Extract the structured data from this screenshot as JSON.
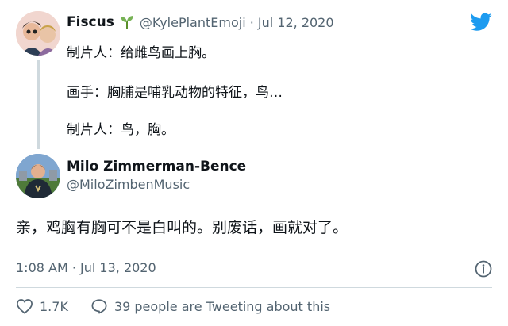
{
  "parent_tweet": {
    "display_name": "Fiscus",
    "handle_date": "@KylePlantEmoji · Jul 12, 2020",
    "lines": [
      "制片人：给雌鸟画上胸。",
      "画手：胸脯是哺乳动物的特征，鸟…",
      "制片人：鸟，胸。"
    ],
    "avatar_icon": "avatar",
    "name_emoji_icon": "seedling-icon"
  },
  "reply_tweet": {
    "display_name": "Milo Zimmerman-Bence",
    "handle": "@MiloZimbenMusic",
    "text": "亲，鸡胸有胸可不是白叫的。别废话，画就对了。",
    "timestamp": "1:08 AM · Jul 13, 2020"
  },
  "actions": {
    "like_count": "1.7K",
    "discussion_text": "39 people are Tweeting about this"
  },
  "colors": {
    "twitter_blue": "#1d9bf0",
    "text_primary": "#0f1419",
    "text_secondary": "#536471",
    "line": "#cfd9de"
  }
}
